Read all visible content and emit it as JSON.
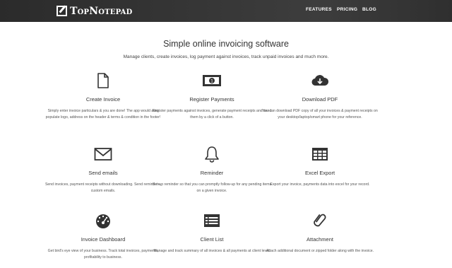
{
  "header": {
    "logo_text": "TopNotepad",
    "nav": {
      "features": "FEATURES",
      "pricing": "PRICING",
      "blog": "BLOG"
    }
  },
  "hero": {
    "title": "Simple online invoicing software",
    "subtitle": "Manage clients, create invoices, log payment against invoices, track unpaid invoices and much more."
  },
  "features": [
    {
      "icon": "document-icon",
      "title": "Create Invoice",
      "desc": "Simply enter invoice particulars & you are done! The app would auto populate logo, address on the header & terms & condition in the footer!"
    },
    {
      "icon": "money-icon",
      "title": "Register Payments",
      "desc": "Register payments against invoices, generate payment receipts and send them by a click of a button."
    },
    {
      "icon": "cloud-download-icon",
      "title": "Download PDF",
      "desc": "You can download PDF copy of all your invoices & payment receipts on your desktop/laptop/smart phone for your reference."
    },
    {
      "icon": "envelope-icon",
      "title": "Send emails",
      "desc": "Send invoices, payment receipts without downloading. Send reminders, custom emails."
    },
    {
      "icon": "bell-icon",
      "title": "Reminder",
      "desc": "Set-up reminder so that you can promptly follow-up for any pending items on a given invoice."
    },
    {
      "icon": "table-icon",
      "title": "Excel Export",
      "desc": "Export your invoice, payments data into excel for your record."
    },
    {
      "icon": "dashboard-icon",
      "title": "Invoice Dashboard",
      "desc": "Get bird's eye view of your business. Track total invoices, payments, profitability to business."
    },
    {
      "icon": "list-icon",
      "title": "Client List",
      "desc": "Manage and track summary of all invoices & all payments at client level."
    },
    {
      "icon": "paperclip-icon",
      "title": "Attachment",
      "desc": "Attach additional document or zipped folder along with the invoice."
    }
  ]
}
